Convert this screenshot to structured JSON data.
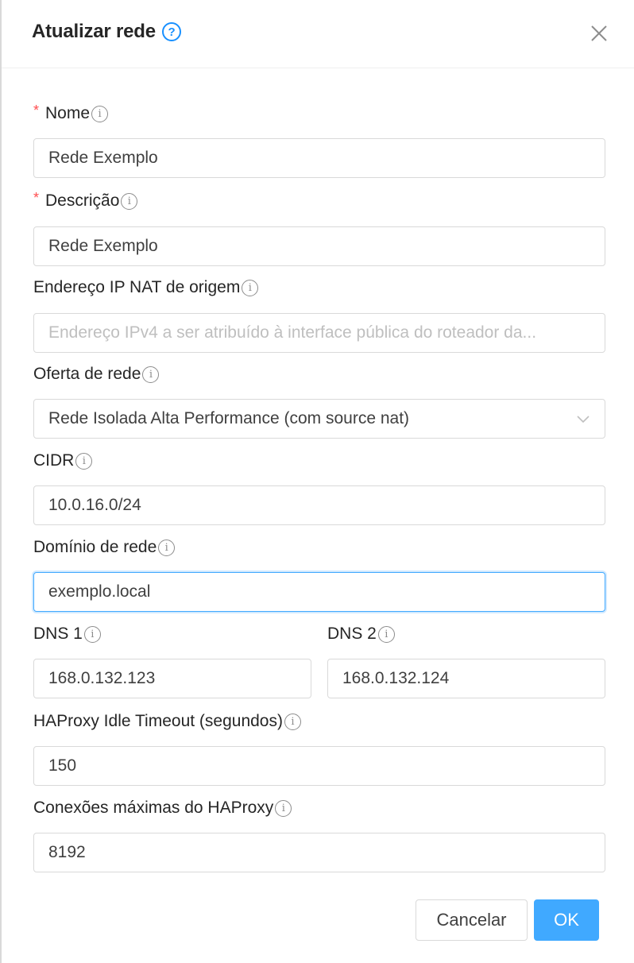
{
  "modal": {
    "title": "Atualizar rede",
    "help_icon": "?"
  },
  "fields": {
    "nome": {
      "label": "Nome",
      "required_mark": "*",
      "value": "Rede Exemplo"
    },
    "descricao": {
      "label": "Descrição",
      "required_mark": "*",
      "value": "Rede Exemplo"
    },
    "nat": {
      "label": "Endereço IP NAT de origem",
      "placeholder": "Endereço IPv4 a ser atribuído à interface pública do roteador da..."
    },
    "oferta": {
      "label": "Oferta de rede",
      "value": "Rede Isolada Alta Performance (com source nat)"
    },
    "cidr": {
      "label": "CIDR",
      "value": "10.0.16.0/24"
    },
    "dominio": {
      "label": "Domínio de rede",
      "value": "exemplo.local"
    },
    "dns1": {
      "label": "DNS 1",
      "value": "168.0.132.123"
    },
    "dns2": {
      "label": "DNS 2",
      "value": "168.0.132.124"
    },
    "haproxy_timeout": {
      "label": "HAProxy Idle Timeout (segundos)",
      "value": "150"
    },
    "haproxy_max": {
      "label": "Conexões máximas do HAProxy",
      "value": "8192"
    }
  },
  "info_icon": "i",
  "buttons": {
    "cancel": "Cancelar",
    "ok": "OK"
  },
  "colors": {
    "primary": "#40a9ff",
    "required": "#ff4d4f",
    "border": "#d9d9d9"
  }
}
